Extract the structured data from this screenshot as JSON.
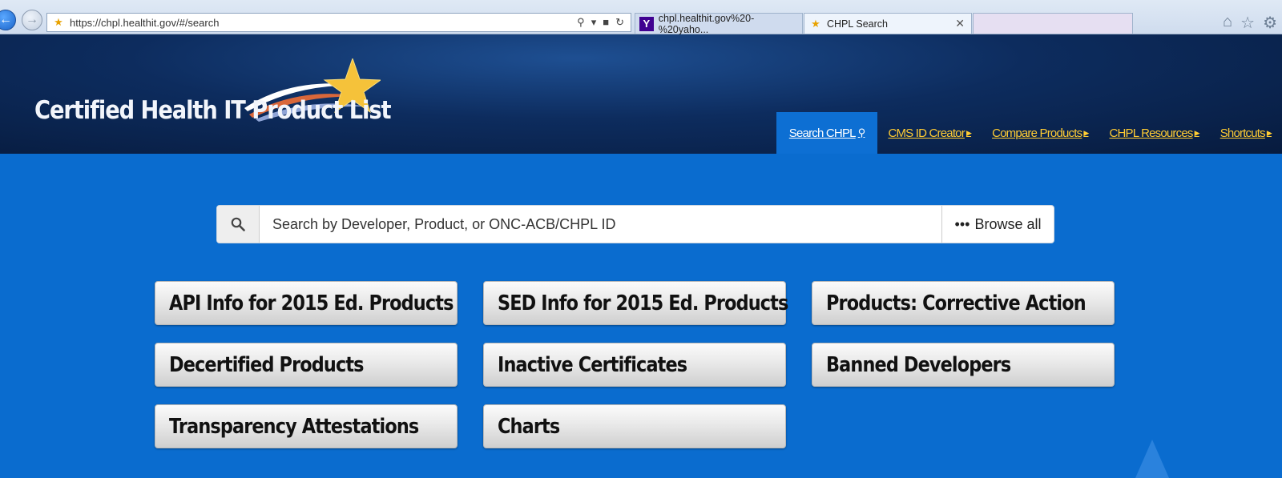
{
  "browser": {
    "url": "https://chpl.healthit.gov/#/search",
    "tabs": [
      {
        "label": "chpl.healthit.gov%20-%20yaho..."
      },
      {
        "label": "CHPL Search"
      },
      {
        "label": ""
      }
    ]
  },
  "header": {
    "site_title": "Certified Health IT Product List",
    "nav": [
      {
        "label": "Search CHPL",
        "active": true
      },
      {
        "label": "CMS ID Creator"
      },
      {
        "label": "Compare Products"
      },
      {
        "label": "CHPL Resources"
      },
      {
        "label": "Shortcuts"
      }
    ]
  },
  "search": {
    "placeholder": "Search by Developer, Product, or ONC-ACB/CHPL ID",
    "browse_label": "Browse all"
  },
  "tiles": [
    {
      "label": "API Info for 2015 Ed. Products"
    },
    {
      "label": "SED Info for 2015 Ed. Products"
    },
    {
      "label": "Products: Corrective Action"
    },
    {
      "label": "Decertified Products"
    },
    {
      "label": "Inactive Certificates"
    },
    {
      "label": "Banned Developers"
    },
    {
      "label": "Transparency Attestations"
    },
    {
      "label": "Charts"
    }
  ],
  "colors": {
    "page_background": "#0a6ccf",
    "nav_link": "#ffcc33",
    "nav_active_background": "#0d6fd3"
  }
}
